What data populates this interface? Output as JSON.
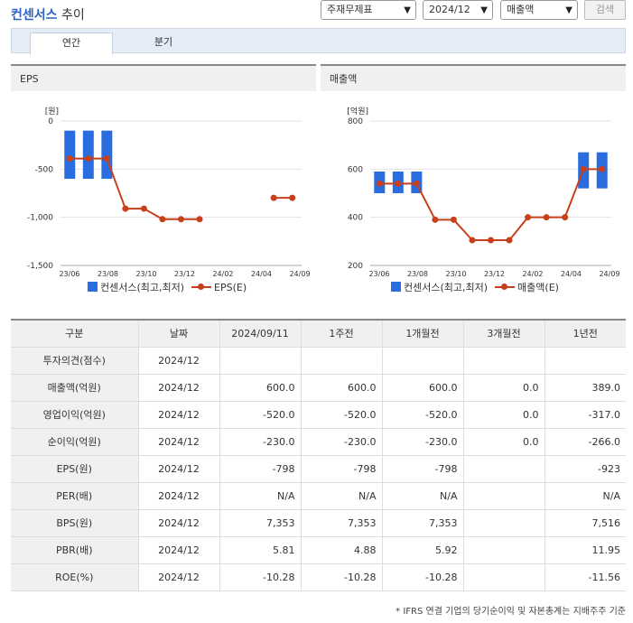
{
  "header": {
    "brand": "컨센서스",
    "suffix": "추이",
    "selects": [
      "주재무제표",
      "2024/12",
      "매출액"
    ],
    "search_label": "검색"
  },
  "tabs": [
    {
      "label": "연간"
    },
    {
      "label": "분기"
    }
  ],
  "charts": [
    {
      "title": "EPS",
      "unit": "[원]",
      "yticks": [
        "0",
        "-500",
        "-1,000",
        "-1,500"
      ],
      "ymin": -1500,
      "ymax": 0,
      "xlabels": [
        "23/06",
        "23/08",
        "23/10",
        "23/12",
        "24/02",
        "24/04",
        "24/09"
      ],
      "bars": [
        [
          -100,
          -600
        ],
        [
          -100,
          -600
        ],
        [
          -100,
          -600
        ]
      ],
      "line": [
        -390,
        -390,
        -390,
        -910,
        -910,
        -1020,
        -1020,
        -1020,
        null,
        null,
        null,
        -798,
        -798
      ],
      "legend_bar": "컨센서스(최고,최저)",
      "legend_line": "EPS(E)"
    },
    {
      "title": "매출액",
      "unit": "[억원]",
      "yticks": [
        "800",
        "600",
        "400",
        "200"
      ],
      "ymin": 200,
      "ymax": 800,
      "xlabels": [
        "23/06",
        "23/08",
        "23/10",
        "23/12",
        "24/02",
        "24/04",
        "24/09"
      ],
      "bars": [
        [
          590,
          500
        ],
        [
          590,
          500
        ],
        [
          590,
          500
        ],
        [
          null,
          null
        ],
        [
          null,
          null
        ],
        [
          null,
          null
        ],
        [
          null,
          null
        ],
        [
          null,
          null
        ],
        [
          null,
          null
        ],
        [
          null,
          null
        ],
        [
          null,
          null
        ],
        [
          670,
          520
        ],
        [
          670,
          520
        ]
      ],
      "line": [
        540,
        540,
        540,
        390,
        390,
        305,
        305,
        305,
        400,
        400,
        400,
        600,
        600
      ],
      "legend_bar": "컨센서스(최고,최저)",
      "legend_line": "매출액(E)"
    }
  ],
  "table": {
    "headers": [
      "구분",
      "날짜",
      "2024/09/11",
      "1주전",
      "1개월전",
      "3개월전",
      "1년전"
    ],
    "rows": [
      [
        "투자의견(점수)",
        "2024/12",
        "",
        "",
        "",
        "",
        ""
      ],
      [
        "매출액(억원)",
        "2024/12",
        "600.0",
        "600.0",
        "600.0",
        "0.0",
        "389.0"
      ],
      [
        "영업이익(억원)",
        "2024/12",
        "-520.0",
        "-520.0",
        "-520.0",
        "0.0",
        "-317.0"
      ],
      [
        "순이익(억원)",
        "2024/12",
        "-230.0",
        "-230.0",
        "-230.0",
        "0.0",
        "-266.0"
      ],
      [
        "EPS(원)",
        "2024/12",
        "-798",
        "-798",
        "-798",
        "",
        "-923"
      ],
      [
        "PER(배)",
        "2024/12",
        "N/A",
        "N/A",
        "N/A",
        "",
        "N/A"
      ],
      [
        "BPS(원)",
        "2024/12",
        "7,353",
        "7,353",
        "7,353",
        "",
        "7,516"
      ],
      [
        "PBR(배)",
        "2024/12",
        "5.81",
        "4.88",
        "5.92",
        "",
        "11.95"
      ],
      [
        "ROE(%)",
        "2024/12",
        "-10.28",
        "-10.28",
        "-10.28",
        "",
        "-11.56"
      ]
    ]
  },
  "footnote": "* IFRS 연결 기업의 당기순이익 및 자본총계는 지배주주 기준"
}
